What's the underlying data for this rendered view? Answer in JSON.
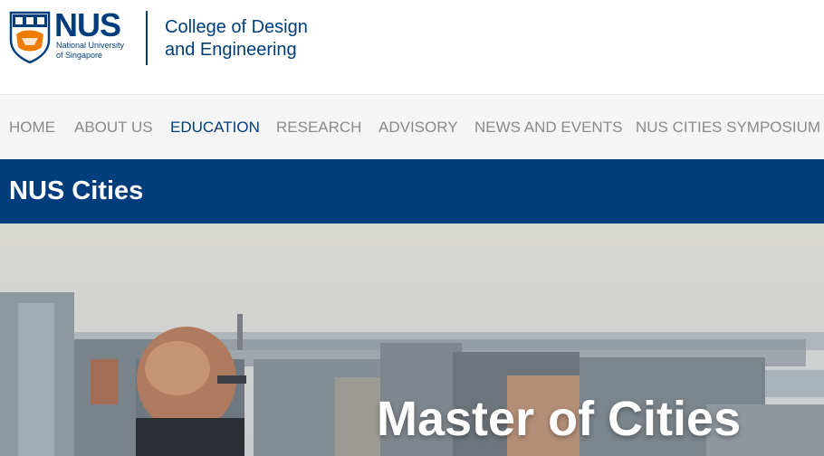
{
  "brand": {
    "logo_word": "NUS",
    "logo_sub_line1": "National University",
    "logo_sub_line2": "of Singapore",
    "college_line1": "College of Design",
    "college_line2": "and Engineering",
    "primary_color": "#003d7c",
    "accent_color": "#ef7c00"
  },
  "nav": {
    "items": [
      {
        "label": "HOME",
        "active": false
      },
      {
        "label": "ABOUT US",
        "active": false
      },
      {
        "label": "EDUCATION",
        "active": true
      },
      {
        "label": "RESEARCH",
        "active": false
      },
      {
        "label": "ADVISORY",
        "active": false
      },
      {
        "label": "NEWS AND EVENTS",
        "active": false
      },
      {
        "label": "NUS CITIES SYMPOSIUM",
        "active": false
      }
    ]
  },
  "section": {
    "title": "NUS Cities"
  },
  "hero": {
    "title": "Master of Cities",
    "image_icon": "city-skyline-photo"
  }
}
